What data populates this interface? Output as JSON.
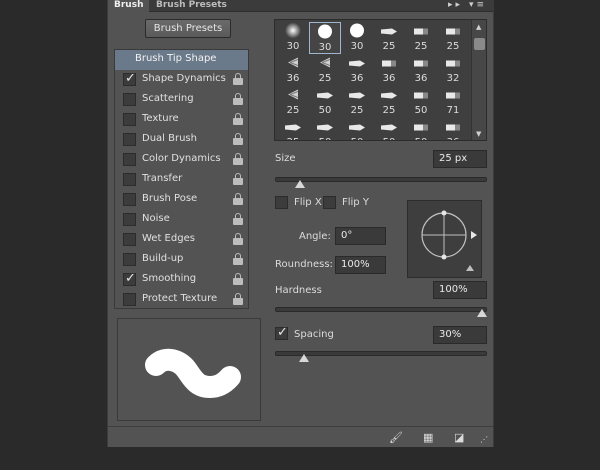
{
  "tabs": [
    {
      "label": "Brush",
      "active": true
    },
    {
      "label": "Brush Presets",
      "active": false
    }
  ],
  "panel_menu_icons": [
    "collapse-icon",
    "panel-menu-icon"
  ],
  "brush_presets_button": "Brush Presets",
  "options_header": "Brush Tip Shape",
  "options": [
    {
      "label": "Shape Dynamics",
      "checked": true,
      "locked": true
    },
    {
      "label": "Scattering",
      "checked": false,
      "locked": true
    },
    {
      "label": "Texture",
      "checked": false,
      "locked": true
    },
    {
      "label": "Dual Brush",
      "checked": false,
      "locked": true
    },
    {
      "label": "Color Dynamics",
      "checked": false,
      "locked": true
    },
    {
      "label": "Transfer",
      "checked": false,
      "locked": true
    },
    {
      "label": "Brush Pose",
      "checked": false,
      "locked": true
    },
    {
      "label": "Noise",
      "checked": false,
      "locked": true
    },
    {
      "label": "Wet Edges",
      "checked": false,
      "locked": true
    },
    {
      "label": "Build-up",
      "checked": false,
      "locked": true
    },
    {
      "label": "Smoothing",
      "checked": true,
      "locked": true
    },
    {
      "label": "Protect Texture",
      "checked": false,
      "locked": true
    }
  ],
  "brush_tips": [
    {
      "size": "30",
      "kind": "soft-round"
    },
    {
      "size": "30",
      "kind": "hard-round",
      "selected": true
    },
    {
      "size": "30",
      "kind": "hard-round"
    },
    {
      "size": "25",
      "kind": "chisel"
    },
    {
      "size": "25",
      "kind": "flat"
    },
    {
      "size": "25",
      "kind": "flat"
    },
    {
      "size": "36",
      "kind": "fan"
    },
    {
      "size": "25",
      "kind": "fan"
    },
    {
      "size": "36",
      "kind": "chisel"
    },
    {
      "size": "36",
      "kind": "flat"
    },
    {
      "size": "36",
      "kind": "flat"
    },
    {
      "size": "32",
      "kind": "flat"
    },
    {
      "size": "25",
      "kind": "fan"
    },
    {
      "size": "50",
      "kind": "chisel"
    },
    {
      "size": "25",
      "kind": "chisel"
    },
    {
      "size": "25",
      "kind": "chisel"
    },
    {
      "size": "50",
      "kind": "flat"
    },
    {
      "size": "71",
      "kind": "flat"
    },
    {
      "size": "25",
      "kind": "chisel"
    },
    {
      "size": "50",
      "kind": "chisel"
    },
    {
      "size": "50",
      "kind": "chisel"
    },
    {
      "size": "50",
      "kind": "chisel"
    },
    {
      "size": "50",
      "kind": "flat"
    },
    {
      "size": "36",
      "kind": "flat"
    }
  ],
  "size": {
    "label": "Size",
    "value": "25 px",
    "slider_fraction": 0.1
  },
  "flip_x": {
    "label": "Flip X",
    "checked": false
  },
  "flip_y": {
    "label": "Flip Y",
    "checked": false
  },
  "angle": {
    "label": "Angle:",
    "value": "0°"
  },
  "roundness": {
    "label": "Roundness:",
    "value": "100%"
  },
  "hardness": {
    "label": "Hardness",
    "value": "100%",
    "slider_fraction": 1.0
  },
  "spacing": {
    "label": "Spacing",
    "checked": true,
    "value": "30%",
    "slider_fraction": 0.12
  },
  "footer_icons": [
    "toggle-live-tip-icon",
    "brush-grid-icon",
    "new-preset-icon"
  ],
  "colors": {
    "panel": "#535353",
    "header_highlight": "#6b7a8a",
    "field": "#3a3a3a"
  }
}
